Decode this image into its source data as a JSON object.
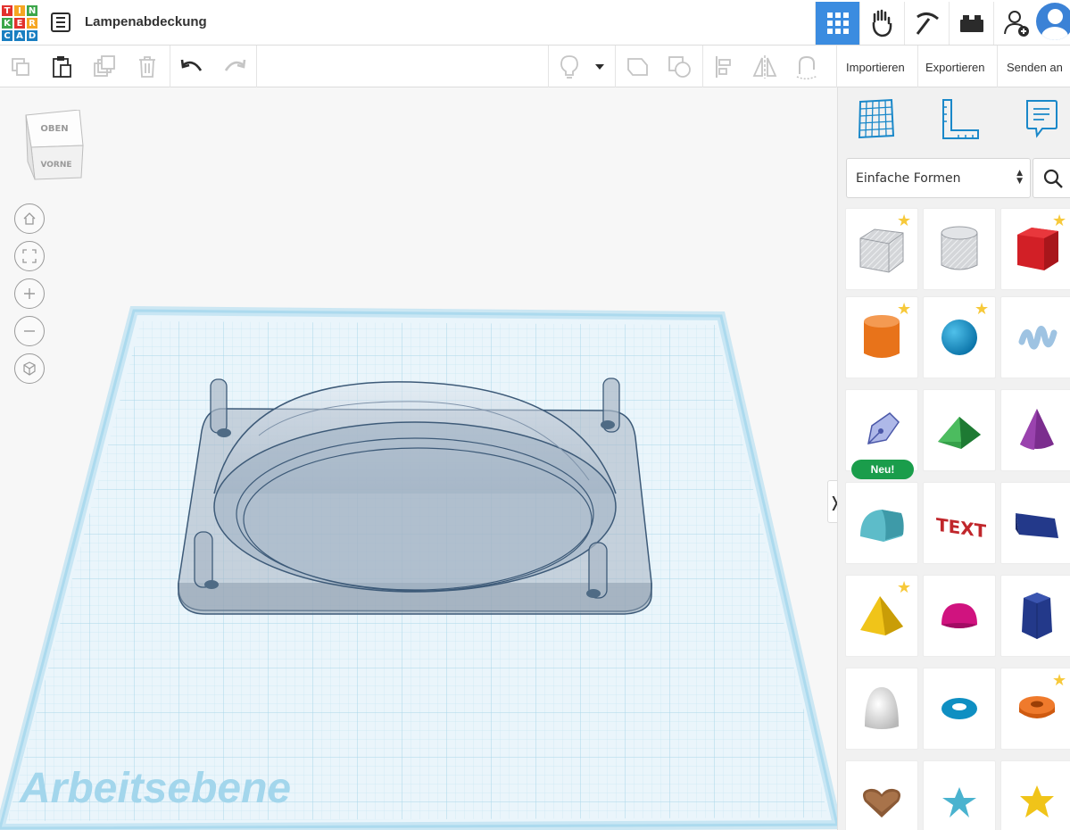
{
  "app": {
    "logo_letters": [
      "T",
      "I",
      "N",
      "K",
      "E",
      "R",
      "C",
      "A",
      "D"
    ],
    "logo_colors": [
      "#e2312d",
      "#f6a623",
      "#3ca64a",
      "#3ca64a",
      "#e2312d",
      "#f6a623",
      "#1a7fc1",
      "#1a7fc1",
      "#1a7fc1"
    ],
    "design_title": "Lampenabdeckung"
  },
  "topnav": {
    "items": [
      {
        "name": "3d-design",
        "icon": "grid-icon",
        "active": true
      },
      {
        "name": "circuits",
        "icon": "circuit-hand-icon",
        "active": false
      },
      {
        "name": "minecraft",
        "icon": "pickaxe-icon",
        "active": false
      },
      {
        "name": "lego",
        "icon": "brick-icon",
        "active": false
      },
      {
        "name": "add-user",
        "icon": "add-user-icon",
        "active": false
      }
    ],
    "accent": "#3b8ce0"
  },
  "toolbar": {
    "import_label": "Importieren",
    "export_label": "Exportieren",
    "send_label": "Senden an"
  },
  "viewcube": {
    "top_label": "OBEN",
    "front_label": "VORNE"
  },
  "viewport": {
    "workplane_label": "Arbeitsebene"
  },
  "panel": {
    "shape_category": "Einfache Formen",
    "new_badge": "Neu!",
    "shapes": [
      {
        "name": "box-hole",
        "icon": "box-hole-icon",
        "star": true
      },
      {
        "name": "cylinder-hole",
        "icon": "cylinder-hole-icon",
        "star": false
      },
      {
        "name": "box",
        "icon": "box-icon",
        "star": true
      },
      {
        "name": "cylinder",
        "icon": "cylinder-icon",
        "star": true
      },
      {
        "name": "sphere",
        "icon": "sphere-icon",
        "star": true
      },
      {
        "name": "scribble",
        "icon": "scribble-icon",
        "star": false
      },
      {
        "name": "shape-generator",
        "icon": "pen-icon",
        "star": false,
        "new": true
      },
      {
        "name": "roof",
        "icon": "roof-icon",
        "star": false
      },
      {
        "name": "cone",
        "icon": "cone-icon",
        "star": false
      },
      {
        "name": "round-roof",
        "icon": "round-roof-icon",
        "star": false
      },
      {
        "name": "text",
        "icon": "text-icon",
        "star": false
      },
      {
        "name": "wedge",
        "icon": "wedge-icon",
        "star": false
      },
      {
        "name": "pyramid",
        "icon": "pyramid-icon",
        "star": true
      },
      {
        "name": "half-sphere",
        "icon": "half-sphere-icon",
        "star": false
      },
      {
        "name": "polygon",
        "icon": "polygon-icon",
        "star": false
      },
      {
        "name": "paraboloid",
        "icon": "paraboloid-icon",
        "star": false
      },
      {
        "name": "torus",
        "icon": "torus-icon",
        "star": false
      },
      {
        "name": "tube",
        "icon": "tube-icon",
        "star": true
      },
      {
        "name": "heart",
        "icon": "heart-icon",
        "star": false
      },
      {
        "name": "star-shape",
        "icon": "star-shape-icon",
        "star": false
      },
      {
        "name": "star-shape-yellow",
        "icon": "star-yellow-icon",
        "star": false
      }
    ]
  }
}
